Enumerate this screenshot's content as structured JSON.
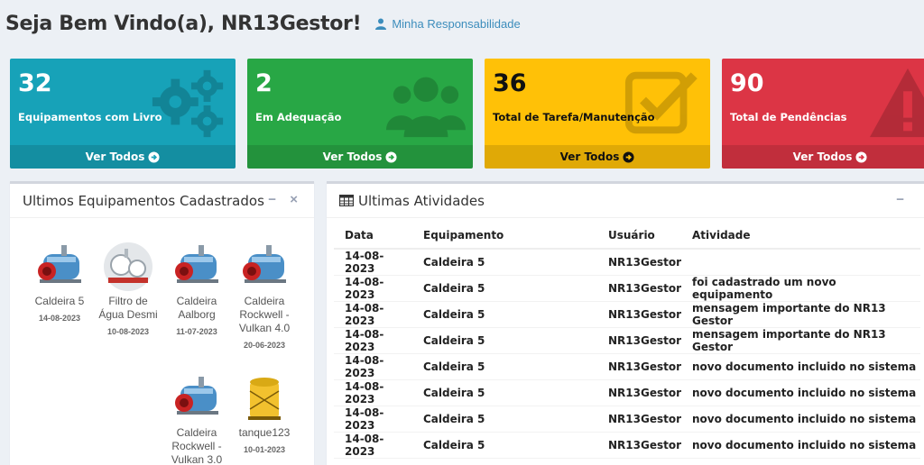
{
  "header": {
    "title": "Seja Bem Vindo(a), NR13Gestor!",
    "resp_label": "Minha Responsabilidade"
  },
  "stat_boxes": [
    {
      "value": "32",
      "label": "Equipamentos com Livro",
      "link": "Ver Todos",
      "color": "#17a2b8",
      "icon": "gears-icon"
    },
    {
      "value": "2",
      "label": "Em Adequação",
      "link": "Ver Todos",
      "color": "#28a745",
      "icon": "users-icon"
    },
    {
      "value": "36",
      "label": "Total de Tarefa/Manutenção",
      "link": "Ver Todos",
      "color": "#ffc107",
      "icon": "check-square-icon"
    },
    {
      "value": "90",
      "label": "Total de Pendências",
      "link": "Ver Todos",
      "color": "#dc3545",
      "icon": "warning-icon"
    }
  ],
  "equipment_panel": {
    "title": "Ultimos Equipamentos Cadastrados",
    "minimize": "−",
    "close": "×",
    "items": [
      {
        "name": "Caldeira 5",
        "date": "14-08-2023",
        "image": "boiler"
      },
      {
        "name": "Filtro de Água Desmi",
        "date": "10-08-2023",
        "image": "filter"
      },
      {
        "name": "Caldeira Aalborg",
        "date": "11-07-2023",
        "image": "boiler"
      },
      {
        "name": "Caldeira Rockwell - Vulkan 4.0",
        "date": "20-06-2023",
        "image": "boiler"
      },
      {
        "name": "Caldeira Rockwell - Vulkan 3.0",
        "date": "",
        "image": "boiler"
      },
      {
        "name": "tanque123",
        "date": "10-01-2023",
        "image": "tank"
      }
    ]
  },
  "activity_panel": {
    "title": "Ultimas Atividades",
    "minimize": "−",
    "columns": [
      "Data",
      "Equipamento",
      "Usuário",
      "Atividade"
    ],
    "rows": [
      [
        "14-08-2023",
        "Caldeira 5",
        "NR13Gestor",
        ""
      ],
      [
        "14-08-2023",
        "Caldeira 5",
        "NR13Gestor",
        "foi cadastrado um novo equipamento"
      ],
      [
        "14-08-2023",
        "Caldeira 5",
        "NR13Gestor",
        "mensagem importante do NR13 Gestor"
      ],
      [
        "14-08-2023",
        "Caldeira 5",
        "NR13Gestor",
        "mensagem importante do NR13 Gestor"
      ],
      [
        "14-08-2023",
        "Caldeira 5",
        "NR13Gestor",
        "novo documento incluido no sistema"
      ],
      [
        "14-08-2023",
        "Caldeira 5",
        "NR13Gestor",
        "novo documento incluido no sistema"
      ],
      [
        "14-08-2023",
        "Caldeira 5",
        "NR13Gestor",
        "novo documento incluido no sistema"
      ],
      [
        "14-08-2023",
        "Caldeira 5",
        "NR13Gestor",
        "novo documento incluido no sistema"
      ]
    ]
  }
}
